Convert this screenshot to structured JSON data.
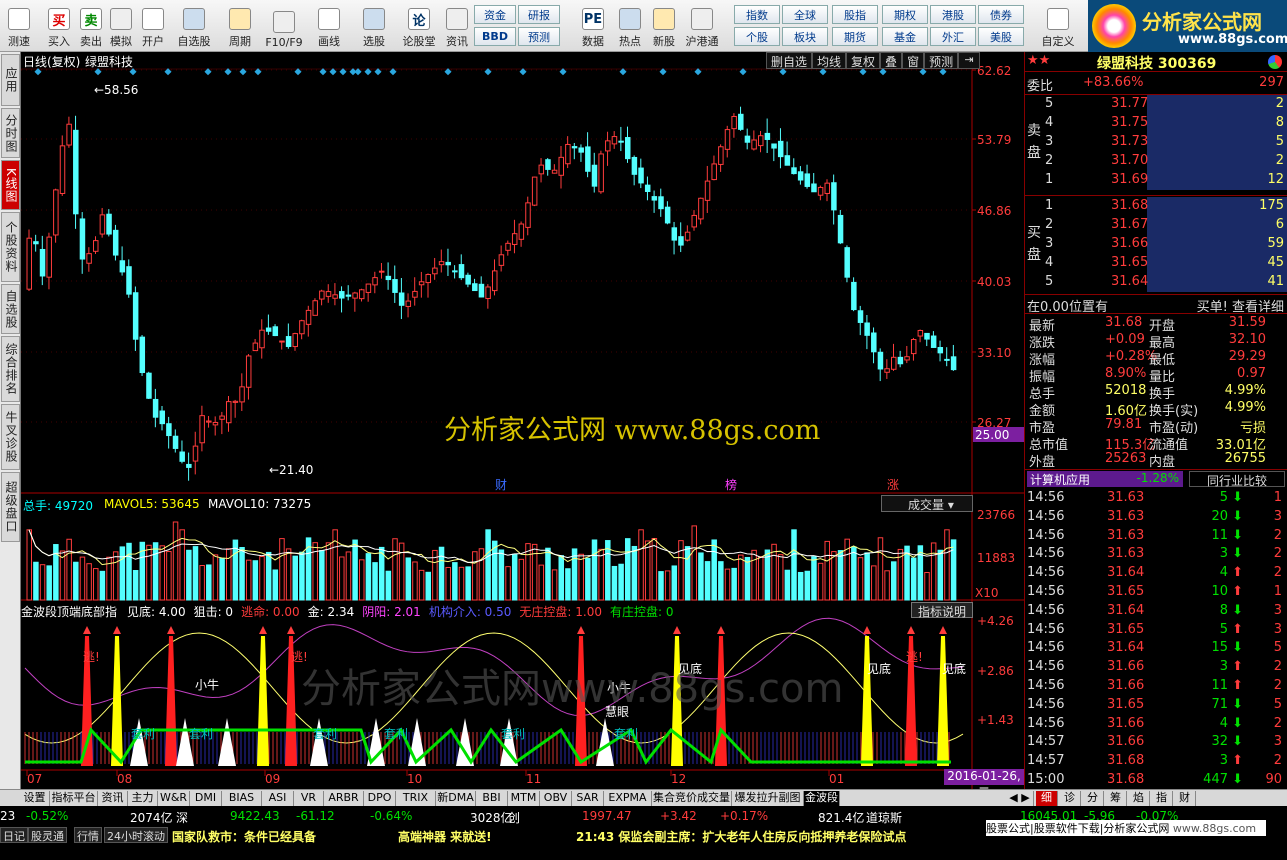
{
  "toolbar": {
    "buttons": [
      {
        "label": "测速",
        "icon": "speed-icon"
      },
      {
        "label": "买入",
        "icon": "buy-icon",
        "glyph": "买"
      },
      {
        "label": "卖出",
        "icon": "sell-icon",
        "glyph": "卖"
      },
      {
        "label": "模拟",
        "icon": "hammer-icon"
      },
      {
        "label": "开户",
        "icon": "lock-icon"
      },
      {
        "label": "自选股",
        "icon": "star-icon"
      },
      {
        "label": "周期",
        "icon": "clock-icon"
      },
      {
        "label": "F10/F9",
        "icon": "f10-icon"
      },
      {
        "label": "画线",
        "icon": "pen-icon"
      },
      {
        "label": "选股",
        "icon": "select-icon"
      },
      {
        "label": "论股堂",
        "icon": "forum-icon",
        "glyph": "论"
      },
      {
        "label": "资讯",
        "icon": "news-icon"
      },
      {
        "label": "数据",
        "icon": "pe-icon",
        "glyph": "PE"
      },
      {
        "label": "热点",
        "icon": "hot-icon"
      },
      {
        "label": "新股",
        "icon": "ipo-icon"
      },
      {
        "label": "沪港通",
        "icon": "hk-icon"
      },
      {
        "label": "自定义",
        "icon": "custom-icon"
      }
    ],
    "grid": [
      [
        "资金",
        "研报",
        "指数",
        "全球",
        "股指",
        "期权",
        "港股",
        "债券"
      ],
      [
        "BBD",
        "预测",
        "个股",
        "板块",
        "期货",
        "基金",
        "外汇",
        "美股"
      ]
    ]
  },
  "logo": {
    "text": "分析家公式网",
    "url": "www.88gs.com"
  },
  "leftnav": [
    "应用",
    "分时图",
    "K线图",
    "个股资料",
    "自选股",
    "综合排名",
    "牛叉诊股",
    "超级盘口"
  ],
  "chart": {
    "title": "日线(复权)",
    "stock_name": "绿盟科技",
    "buttons": [
      "删自选",
      "均线",
      "复权",
      "叠",
      "窗",
      "预测"
    ],
    "price_axis": [
      "62.62",
      "53.79",
      "46.86",
      "40.03",
      "33.10",
      "26.27"
    ],
    "current_price_tag": "25.00",
    "max_label": "←58.56",
    "min_label": "←21.40",
    "markers": [
      "财",
      "榜",
      "涨"
    ],
    "watermark": "分析家公式网 www.88gs.com",
    "volume": {
      "label": "总手: 49720",
      "ma5": "MAVOL5: 53645",
      "ma10": "MAVOL10: 73275",
      "selector": "成交量",
      "axis": [
        "23766",
        "11883"
      ],
      "unit": "X10"
    },
    "indicator": {
      "name": "金波段顶端底部指",
      "items": [
        {
          "t": "见底: 4.00",
          "c": "#ffffff"
        },
        {
          "t": "狙击: 0",
          "c": "#ffffff"
        },
        {
          "t": "逃命: 0.00",
          "c": "#ff3c3c"
        },
        {
          "t": "金: 2.34",
          "c": "#ffffff"
        },
        {
          "t": "阴阳: 2.01",
          "c": "#ff44ff"
        },
        {
          "t": "机构介入: 0.50",
          "c": "#5a5aff"
        },
        {
          "t": "无庄控盘: 1.00",
          "c": "#ff3c3c"
        },
        {
          "t": "有庄控盘: 0",
          "c": "#00e000"
        }
      ],
      "button": "指标说明",
      "axis": [
        "+4.26",
        "+2.86",
        "+1.43"
      ],
      "labels": [
        "逃!",
        "逃!",
        "逃!",
        "小牛",
        "小牛",
        "慧眼",
        "见底",
        "见底",
        "见底",
        "套利",
        "套利",
        "套利",
        "套利",
        "套利",
        "套利"
      ],
      "watermark": "分析家公式网www.88gs.com"
    },
    "date_axis": [
      "07",
      "08",
      "09",
      "10",
      "11",
      "12",
      "01"
    ],
    "date_tag": "2016-01-26,二"
  },
  "chart_data": {
    "type": "candlestick",
    "title": "日线(复权) 绿盟科技",
    "price_high": 58.56,
    "price_low": 21.4,
    "ylim": [
      21.4,
      62.62
    ],
    "xlabels": [
      "07",
      "08",
      "09",
      "10",
      "11",
      "12",
      "01"
    ],
    "last_close": 31.68,
    "volume_total": 49720,
    "mavol5": 53645,
    "mavol10": 73275
  },
  "quote": {
    "name": "绿盟科技",
    "code": "300369",
    "webi": "委比",
    "webi_val": "+83.66%",
    "webi_diff": "297",
    "asks": [
      {
        "lvl": "5",
        "p": "31.77",
        "v": "2"
      },
      {
        "lvl": "4",
        "p": "31.75",
        "v": "8"
      },
      {
        "lvl": "3",
        "p": "31.73",
        "v": "5"
      },
      {
        "lvl": "2",
        "p": "31.70",
        "v": "2"
      },
      {
        "lvl": "1",
        "p": "31.69",
        "v": "12"
      }
    ],
    "bids": [
      {
        "lvl": "1",
        "p": "31.68",
        "v": "175"
      },
      {
        "lvl": "2",
        "p": "31.67",
        "v": "6"
      },
      {
        "lvl": "3",
        "p": "31.66",
        "v": "59"
      },
      {
        "lvl": "4",
        "p": "31.65",
        "v": "45"
      },
      {
        "lvl": "5",
        "p": "31.64",
        "v": "41"
      }
    ],
    "ask_label": "卖盘",
    "bid_label": "买盘",
    "pos_text": "在0.00位置有",
    "detail_text": "买单! 查看详细",
    "stats": [
      [
        "最新",
        "31.68",
        "开盘",
        "31.59"
      ],
      [
        "涨跌",
        "+0.09",
        "最高",
        "32.10"
      ],
      [
        "涨幅",
        "+0.28%",
        "最低",
        "29.29"
      ],
      [
        "振幅",
        "8.90%",
        "量比",
        "0.97"
      ],
      [
        "总手",
        "52018",
        "换手",
        "4.99%"
      ],
      [
        "金额",
        "1.60亿",
        "换手(实)",
        "4.99%"
      ],
      [
        "市盈",
        "79.81",
        "市盈(动)",
        "亏损"
      ],
      [
        "总市值",
        "115.3亿",
        "流通值",
        "33.01亿"
      ],
      [
        "外盘",
        "25263",
        "内盘",
        "26755"
      ]
    ],
    "sector": {
      "name": "计算机应用",
      "change": "-1.28%",
      "compare": "同行业比较"
    },
    "ticks": [
      [
        "14:56",
        "31.63",
        "5",
        "d",
        "1"
      ],
      [
        "14:56",
        "31.63",
        "20",
        "d",
        "3"
      ],
      [
        "14:56",
        "31.63",
        "11",
        "d",
        "2"
      ],
      [
        "14:56",
        "31.63",
        "3",
        "d",
        "2"
      ],
      [
        "14:56",
        "31.64",
        "4",
        "u",
        "2"
      ],
      [
        "14:56",
        "31.65",
        "10",
        "u",
        "1"
      ],
      [
        "14:56",
        "31.64",
        "8",
        "d",
        "3"
      ],
      [
        "14:56",
        "31.65",
        "5",
        "u",
        "3"
      ],
      [
        "14:56",
        "31.64",
        "15",
        "d",
        "5"
      ],
      [
        "14:56",
        "31.66",
        "3",
        "u",
        "2"
      ],
      [
        "14:56",
        "31.66",
        "11",
        "u",
        "2"
      ],
      [
        "14:56",
        "31.65",
        "71",
        "d",
        "5"
      ],
      [
        "14:56",
        "31.66",
        "4",
        "d",
        "2"
      ],
      [
        "14:57",
        "31.66",
        "32",
        "d",
        "3"
      ],
      [
        "14:57",
        "31.68",
        "3",
        "u",
        "2"
      ],
      [
        "15:00",
        "31.68",
        "447",
        "d",
        "90"
      ]
    ]
  },
  "bottom_tabs": [
    "设置",
    "指标平台",
    "资讯",
    "主力",
    "W&R",
    "DMI",
    "BIAS",
    "ASI",
    "VR",
    "ARBR",
    "DPO",
    "TRIX",
    "新DMA",
    "BBI",
    "MTM",
    "OBV",
    "SAR",
    "EXPMA",
    "集合竞价成交量YH",
    "爆发拉升副图",
    "金波段"
  ],
  "right_tabs": [
    "细",
    "诊",
    "分",
    "筹",
    "焰",
    "指",
    "财"
  ],
  "index_bar": [
    {
      "t": "23",
      "c": "#fff"
    },
    {
      "t": "-0.52%",
      "c": "#00e000"
    },
    {
      "t": "2074亿",
      "c": "#fff"
    },
    {
      "t": "深",
      "c": "#fff"
    },
    {
      "t": "9422.43",
      "c": "#00e000"
    },
    {
      "t": "-61.12",
      "c": "#00e000"
    },
    {
      "t": "-0.64%",
      "c": "#00e000"
    },
    {
      "t": "3028亿",
      "c": "#fff"
    },
    {
      "t": "创",
      "c": "#fff"
    },
    {
      "t": "1997.47",
      "c": "#ff3c3c"
    },
    {
      "t": "+3.42",
      "c": "#ff3c3c"
    },
    {
      "t": "+0.17%",
      "c": "#ff3c3c"
    },
    {
      "t": "821.4亿",
      "c": "#fff"
    },
    {
      "t": "道琼斯",
      "c": "#fff"
    },
    {
      "t": "16045.01",
      "c": "#00e000"
    },
    {
      "t": "-5.96",
      "c": "#00e000"
    },
    {
      "t": "-0.07%",
      "c": "#00e000"
    }
  ],
  "news": {
    "tabs": [
      "日记",
      "股灵通",
      "行情",
      "24小时滚动"
    ],
    "items": [
      "国家队救市：条件已经具备",
      "高端神器 来就送!",
      "21:43 保监会副主席：扩大老年人住房反向抵押养老保险试点"
    ],
    "ad": "股票公式|股票软件下载|分析家公式网",
    "ad_url": "www.88gs.com"
  }
}
